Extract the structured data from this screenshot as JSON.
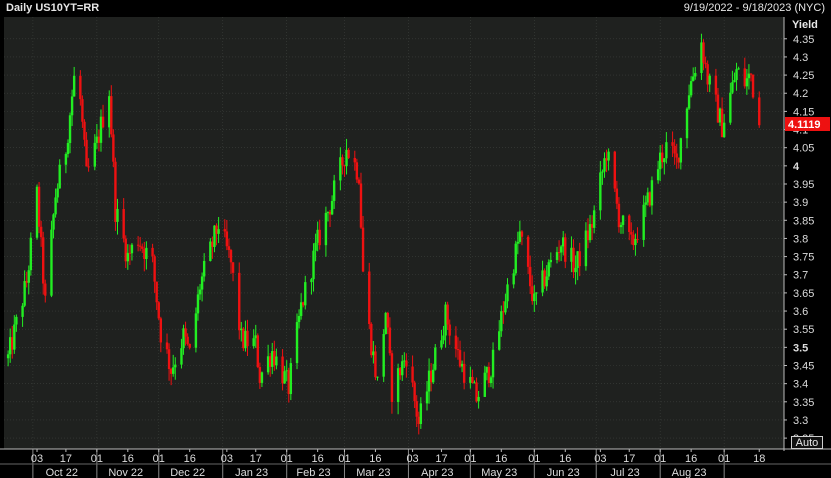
{
  "header": {
    "title": "Daily US10YT=RR",
    "date_range": "9/19/2022 - 9/18/2023 (NYC)",
    "auto_label": "Auto"
  },
  "colors": {
    "background": "#000000",
    "plot_background": "#1f211f",
    "up": "#22ee22",
    "down": "#ee1111",
    "grid": "#3c403c",
    "text": "#dcdcdc"
  },
  "chart_data": {
    "type": "candlestick",
    "title": "Daily US10YT=RR",
    "ylabel": "Yield",
    "ylim": [
      3.22,
      4.41
    ],
    "y_ticks": [
      3.25,
      3.3,
      3.35,
      3.4,
      3.45,
      3.5,
      3.55,
      3.6,
      3.65,
      3.7,
      3.75,
      3.8,
      3.85,
      3.9,
      3.95,
      4,
      4.05,
      4.1,
      4.15,
      4.2,
      4.25,
      4.3,
      4.35
    ],
    "y_tick_labels": [
      "3.25",
      "3.3",
      "3.35",
      "3.4",
      "3.45",
      "3.5",
      "3.55",
      "3.6",
      "3.65",
      "3.7",
      "3.75",
      "3.8",
      "3.85",
      "3.9",
      "3.95",
      "4",
      "4.05",
      "4.1",
      "4.15",
      "4.2",
      "4.25",
      "4.3",
      "4.35"
    ],
    "bold_ticks": [
      "3.5",
      "4"
    ],
    "last_value_label": "4.1119",
    "last_value": 4.1119,
    "x_tick_labels": [
      {
        "date": "2022-10-03",
        "label": "03"
      },
      {
        "date": "2022-10-17",
        "label": "17"
      },
      {
        "date": "2022-11-01",
        "label": "01"
      },
      {
        "date": "2022-11-16",
        "label": "16"
      },
      {
        "date": "2022-12-01",
        "label": "01"
      },
      {
        "date": "2022-12-16",
        "label": "16"
      },
      {
        "date": "2023-01-03",
        "label": "03"
      },
      {
        "date": "2023-01-17",
        "label": "17"
      },
      {
        "date": "2023-02-01",
        "label": "01"
      },
      {
        "date": "2023-02-16",
        "label": "16"
      },
      {
        "date": "2023-03-01",
        "label": "01"
      },
      {
        "date": "2023-03-16",
        "label": "16"
      },
      {
        "date": "2023-04-03",
        "label": "03"
      },
      {
        "date": "2023-04-17",
        "label": "17"
      },
      {
        "date": "2023-05-01",
        "label": "01"
      },
      {
        "date": "2023-05-16",
        "label": "16"
      },
      {
        "date": "2023-06-01",
        "label": "01"
      },
      {
        "date": "2023-06-16",
        "label": "16"
      },
      {
        "date": "2023-07-03",
        "label": "03"
      },
      {
        "date": "2023-07-17",
        "label": "17"
      },
      {
        "date": "2023-08-01",
        "label": "01"
      },
      {
        "date": "2023-08-16",
        "label": "16"
      },
      {
        "date": "2023-09-01",
        "label": "01"
      },
      {
        "date": "2023-09-18",
        "label": "18"
      }
    ],
    "month_labels": [
      {
        "date": "2022-10-15",
        "label": "Oct 22"
      },
      {
        "date": "2022-11-15",
        "label": "Nov 22"
      },
      {
        "date": "2022-12-15",
        "label": "Dec 22"
      },
      {
        "date": "2023-01-15",
        "label": "Jan 23"
      },
      {
        "date": "2023-02-14",
        "label": "Feb 23"
      },
      {
        "date": "2023-03-15",
        "label": "Mar 23"
      },
      {
        "date": "2023-04-15",
        "label": "Apr 23"
      },
      {
        "date": "2023-05-15",
        "label": "May 23"
      },
      {
        "date": "2023-06-15",
        "label": "Jun 23"
      },
      {
        "date": "2023-07-15",
        "label": "Jul 23"
      },
      {
        "date": "2023-08-15",
        "label": "Aug 23"
      }
    ],
    "month_boundaries": [
      "2022-10-01",
      "2022-11-01",
      "2022-12-01",
      "2023-01-01",
      "2023-02-01",
      "2023-03-01",
      "2023-04-01",
      "2023-05-01",
      "2023-06-01",
      "2023-07-01",
      "2023-08-01",
      "2023-09-01"
    ],
    "x_range": [
      "2022-09-19",
      "2023-09-18"
    ],
    "closes": [
      {
        "date": "2022-09-19",
        "close": 3.47
      },
      {
        "date": "2022-09-28",
        "close": 3.68
      },
      {
        "date": "2022-10-03",
        "close": 3.92
      },
      {
        "date": "2022-10-07",
        "close": 3.62
      },
      {
        "date": "2022-10-12",
        "close": 3.92
      },
      {
        "date": "2022-10-17",
        "close": 4.05
      },
      {
        "date": "2022-10-21",
        "close": 4.24
      },
      {
        "date": "2022-10-24",
        "close": 4.18
      },
      {
        "date": "2022-10-27",
        "close": 3.97
      },
      {
        "date": "2022-11-01",
        "close": 4.06
      },
      {
        "date": "2022-11-07",
        "close": 4.21
      },
      {
        "date": "2022-11-10",
        "close": 3.88
      },
      {
        "date": "2022-11-16",
        "close": 3.75
      },
      {
        "date": "2022-11-21",
        "close": 3.8
      },
      {
        "date": "2022-11-28",
        "close": 3.73
      },
      {
        "date": "2022-12-02",
        "close": 3.54
      },
      {
        "date": "2022-12-07",
        "close": 3.44
      },
      {
        "date": "2022-12-13",
        "close": 3.53
      },
      {
        "date": "2022-12-16",
        "close": 3.48
      },
      {
        "date": "2022-12-21",
        "close": 3.67
      },
      {
        "date": "2022-12-30",
        "close": 3.84
      },
      {
        "date": "2023-01-05",
        "close": 3.73
      },
      {
        "date": "2023-01-10",
        "close": 3.52
      },
      {
        "date": "2023-01-17",
        "close": 3.51
      },
      {
        "date": "2023-01-19",
        "close": 3.42
      },
      {
        "date": "2023-01-25",
        "close": 3.49
      },
      {
        "date": "2023-02-02",
        "close": 3.39
      },
      {
        "date": "2023-02-08",
        "close": 3.61
      },
      {
        "date": "2023-02-16",
        "close": 3.79
      },
      {
        "date": "2023-02-23",
        "close": 3.91
      },
      {
        "date": "2023-03-02",
        "close": 4.05
      },
      {
        "date": "2023-03-08",
        "close": 3.98
      },
      {
        "date": "2023-03-10",
        "close": 3.71
      },
      {
        "date": "2023-03-13",
        "close": 3.55
      },
      {
        "date": "2023-03-17",
        "close": 3.4
      },
      {
        "date": "2023-03-21",
        "close": 3.6
      },
      {
        "date": "2023-03-24",
        "close": 3.38
      },
      {
        "date": "2023-03-31",
        "close": 3.48
      },
      {
        "date": "2023-04-06",
        "close": 3.29
      },
      {
        "date": "2023-04-12",
        "close": 3.43
      },
      {
        "date": "2023-04-19",
        "close": 3.59
      },
      {
        "date": "2023-04-26",
        "close": 3.46
      },
      {
        "date": "2023-05-04",
        "close": 3.36
      },
      {
        "date": "2023-05-12",
        "close": 3.46
      },
      {
        "date": "2023-05-18",
        "close": 3.64
      },
      {
        "date": "2023-05-25",
        "close": 3.81
      },
      {
        "date": "2023-06-01",
        "close": 3.62
      },
      {
        "date": "2023-06-08",
        "close": 3.72
      },
      {
        "date": "2023-06-14",
        "close": 3.79
      },
      {
        "date": "2023-06-21",
        "close": 3.72
      },
      {
        "date": "2023-06-29",
        "close": 3.84
      },
      {
        "date": "2023-07-06",
        "close": 4.04
      },
      {
        "date": "2023-07-12",
        "close": 3.86
      },
      {
        "date": "2023-07-18",
        "close": 3.78
      },
      {
        "date": "2023-07-25",
        "close": 3.88
      },
      {
        "date": "2023-08-01",
        "close": 4.02
      },
      {
        "date": "2023-08-04",
        "close": 4.05
      },
      {
        "date": "2023-08-09",
        "close": 4.01
      },
      {
        "date": "2023-08-15",
        "close": 4.21
      },
      {
        "date": "2023-08-21",
        "close": 4.34
      },
      {
        "date": "2023-08-24",
        "close": 4.24
      },
      {
        "date": "2023-08-31",
        "close": 4.11
      },
      {
        "date": "2023-09-07",
        "close": 4.26
      },
      {
        "date": "2023-09-11",
        "close": 4.23
      },
      {
        "date": "2023-09-14",
        "close": 4.25
      },
      {
        "date": "2023-09-18",
        "close": 4.11
      }
    ],
    "grid": true
  }
}
